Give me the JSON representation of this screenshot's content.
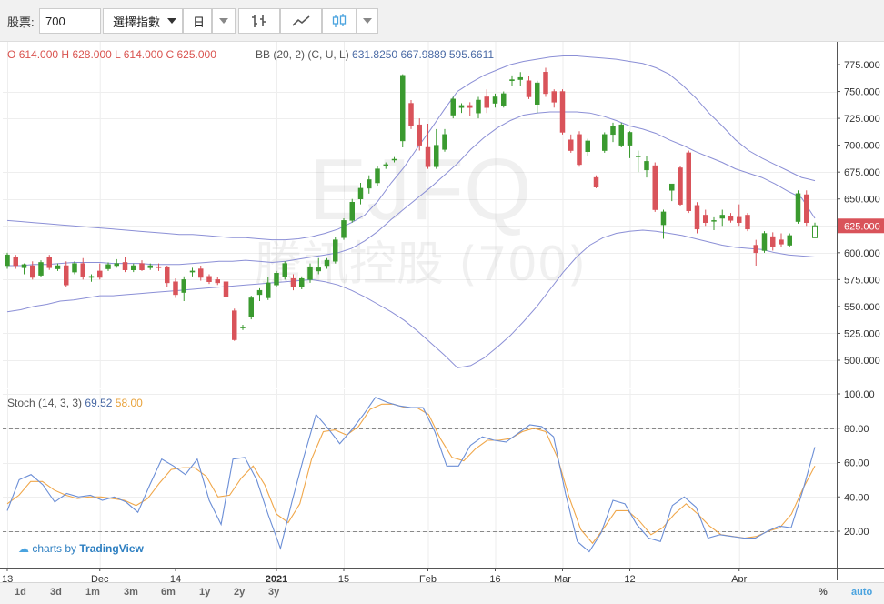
{
  "toolbar": {
    "stock_label": "股票:",
    "stock_value": "700",
    "index_select": "選擇指數",
    "period_select": "日"
  },
  "legend": {
    "o_label": "O",
    "o_value": "614.000",
    "h_label": "H",
    "h_value": "628.000",
    "l_label": "L",
    "l_value": "614.000",
    "c_label": "C",
    "c_value": "625.000",
    "bb_label": "BB (20, 2) (C, U, L)",
    "bb_c": "631.8250",
    "bb_u": "667.9889",
    "bb_l": "595.6611",
    "stoch_label": "Stoch (14, 3, 3)",
    "stoch_k": "69.52",
    "stoch_d": "58.00"
  },
  "watermark": {
    "line1": "EJFQ",
    "line2": "騰訊控股 (700)"
  },
  "branding": {
    "prefix": "charts by",
    "name": "TradingView"
  },
  "ranges": [
    "1d",
    "3d",
    "1m",
    "3m",
    "6m",
    "1y",
    "2y",
    "3y"
  ],
  "bottom_right": {
    "percent": "%",
    "auto": "auto"
  },
  "colors": {
    "up": "#3a9a2f",
    "down": "#d9535a",
    "bb": "#8b8fd6",
    "stoch_k": "#6b8ed6",
    "stoch_d": "#f0a74a"
  },
  "chart_data": [
    {
      "type": "candlestick",
      "y_axis_ticks": [
        "775.000",
        "750.000",
        "725.000",
        "700.000",
        "675.000",
        "650.000",
        "625.000",
        "600.000",
        "575.000",
        "550.000",
        "525.000",
        "500.000"
      ],
      "ylim": [
        480,
        790
      ],
      "last_price_label": "625.000",
      "x_axis_ticks": [
        "13",
        "Dec",
        "14",
        "2021",
        "15",
        "Feb",
        "16",
        "Mar",
        "12",
        "Apr"
      ],
      "x_tick_index": [
        0,
        11,
        20,
        32,
        40,
        50,
        58,
        66,
        74,
        87
      ],
      "candles": [
        {
          "o": 588,
          "h": 600,
          "l": 585,
          "c": 598
        },
        {
          "o": 596,
          "h": 598,
          "l": 585,
          "c": 588
        },
        {
          "o": 586,
          "h": 590,
          "l": 580,
          "c": 589
        },
        {
          "o": 588,
          "h": 592,
          "l": 575,
          "c": 577
        },
        {
          "o": 579,
          "h": 593,
          "l": 577,
          "c": 591
        },
        {
          "o": 596,
          "h": 598,
          "l": 584,
          "c": 586
        },
        {
          "o": 585,
          "h": 590,
          "l": 583,
          "c": 588
        },
        {
          "o": 588,
          "h": 592,
          "l": 568,
          "c": 570
        },
        {
          "o": 582,
          "h": 592,
          "l": 580,
          "c": 590
        },
        {
          "o": 590,
          "h": 595,
          "l": 575,
          "c": 578
        },
        {
          "o": 577,
          "h": 580,
          "l": 573,
          "c": 578
        },
        {
          "o": 583,
          "h": 590,
          "l": 575,
          "c": 577
        },
        {
          "o": 585,
          "h": 591,
          "l": 583,
          "c": 589
        },
        {
          "o": 588,
          "h": 594,
          "l": 586,
          "c": 590
        },
        {
          "o": 591,
          "h": 596,
          "l": 582,
          "c": 584
        },
        {
          "o": 584,
          "h": 590,
          "l": 582,
          "c": 588
        },
        {
          "o": 590,
          "h": 593,
          "l": 583,
          "c": 584
        },
        {
          "o": 586,
          "h": 590,
          "l": 584,
          "c": 588
        },
        {
          "o": 587,
          "h": 590,
          "l": 583,
          "c": 586
        },
        {
          "o": 587,
          "h": 588,
          "l": 568,
          "c": 572
        },
        {
          "o": 573,
          "h": 576,
          "l": 558,
          "c": 561
        },
        {
          "o": 563,
          "h": 578,
          "l": 555,
          "c": 575
        },
        {
          "o": 582,
          "h": 586,
          "l": 578,
          "c": 583
        },
        {
          "o": 585,
          "h": 588,
          "l": 574,
          "c": 577
        },
        {
          "o": 578,
          "h": 580,
          "l": 571,
          "c": 573
        },
        {
          "o": 575,
          "h": 577,
          "l": 570,
          "c": 572
        },
        {
          "o": 573,
          "h": 576,
          "l": 555,
          "c": 559
        },
        {
          "o": 546,
          "h": 548,
          "l": 518,
          "c": 519
        },
        {
          "o": 530,
          "h": 533,
          "l": 528,
          "c": 531
        },
        {
          "o": 540,
          "h": 560,
          "l": 538,
          "c": 558
        },
        {
          "o": 561,
          "h": 567,
          "l": 555,
          "c": 565
        },
        {
          "o": 558,
          "h": 577,
          "l": 556,
          "c": 572
        },
        {
          "o": 570,
          "h": 583,
          "l": 568,
          "c": 581
        },
        {
          "o": 578,
          "h": 592,
          "l": 575,
          "c": 590
        },
        {
          "o": 576,
          "h": 580,
          "l": 565,
          "c": 568
        },
        {
          "o": 568,
          "h": 578,
          "l": 566,
          "c": 576
        },
        {
          "o": 575,
          "h": 590,
          "l": 572,
          "c": 587
        },
        {
          "o": 583,
          "h": 595,
          "l": 580,
          "c": 586
        },
        {
          "o": 588,
          "h": 595,
          "l": 585,
          "c": 593
        },
        {
          "o": 592,
          "h": 615,
          "l": 590,
          "c": 612
        },
        {
          "o": 614,
          "h": 632,
          "l": 612,
          "c": 630
        },
        {
          "o": 630,
          "h": 650,
          "l": 628,
          "c": 647
        },
        {
          "o": 650,
          "h": 665,
          "l": 645,
          "c": 660
        },
        {
          "o": 660,
          "h": 672,
          "l": 655,
          "c": 668
        },
        {
          "o": 665,
          "h": 681,
          "l": 662,
          "c": 678
        },
        {
          "o": 682,
          "h": 684,
          "l": 678,
          "c": 682
        },
        {
          "o": 687,
          "h": 689,
          "l": 684,
          "c": 687
        },
        {
          "o": 704,
          "h": 766,
          "l": 698,
          "c": 765
        },
        {
          "o": 739,
          "h": 742,
          "l": 715,
          "c": 718
        },
        {
          "o": 719,
          "h": 725,
          "l": 695,
          "c": 700
        },
        {
          "o": 698,
          "h": 720,
          "l": 678,
          "c": 680
        },
        {
          "o": 680,
          "h": 715,
          "l": 678,
          "c": 700
        },
        {
          "o": 696,
          "h": 715,
          "l": 694,
          "c": 710
        },
        {
          "o": 728,
          "h": 745,
          "l": 725,
          "c": 743
        },
        {
          "o": 735,
          "h": 739,
          "l": 730,
          "c": 737
        },
        {
          "o": 737,
          "h": 740,
          "l": 727,
          "c": 735
        },
        {
          "o": 730,
          "h": 745,
          "l": 725,
          "c": 742
        },
        {
          "o": 745,
          "h": 752,
          "l": 730,
          "c": 735
        },
        {
          "o": 739,
          "h": 748,
          "l": 735,
          "c": 745
        },
        {
          "o": 737,
          "h": 750,
          "l": 735,
          "c": 748
        },
        {
          "o": 760,
          "h": 765,
          "l": 755,
          "c": 761
        },
        {
          "o": 761,
          "h": 768,
          "l": 755,
          "c": 763
        },
        {
          "o": 760,
          "h": 764,
          "l": 743,
          "c": 745
        },
        {
          "o": 738,
          "h": 760,
          "l": 730,
          "c": 758
        },
        {
          "o": 768,
          "h": 772,
          "l": 745,
          "c": 748
        },
        {
          "o": 750,
          "h": 752,
          "l": 735,
          "c": 740
        },
        {
          "o": 750,
          "h": 752,
          "l": 710,
          "c": 712
        },
        {
          "o": 705,
          "h": 710,
          "l": 693,
          "c": 695
        },
        {
          "o": 710,
          "h": 713,
          "l": 680,
          "c": 682
        },
        {
          "o": 694,
          "h": 706,
          "l": 690,
          "c": 704
        },
        {
          "o": 670,
          "h": 672,
          "l": 660,
          "c": 661
        },
        {
          "o": 695,
          "h": 712,
          "l": 693,
          "c": 710
        },
        {
          "o": 710,
          "h": 721,
          "l": 703,
          "c": 718
        },
        {
          "o": 700,
          "h": 721,
          "l": 698,
          "c": 719
        },
        {
          "o": 700,
          "h": 713,
          "l": 688,
          "c": 712
        },
        {
          "o": 690,
          "h": 695,
          "l": 675,
          "c": 690
        },
        {
          "o": 677,
          "h": 690,
          "l": 670,
          "c": 685
        },
        {
          "o": 681,
          "h": 684,
          "l": 638,
          "c": 640
        },
        {
          "o": 626,
          "h": 640,
          "l": 613,
          "c": 638
        },
        {
          "o": 658,
          "h": 663,
          "l": 648,
          "c": 664
        },
        {
          "o": 679,
          "h": 681,
          "l": 643,
          "c": 645
        },
        {
          "o": 693,
          "h": 695,
          "l": 637,
          "c": 639
        },
        {
          "o": 644,
          "h": 647,
          "l": 618,
          "c": 622
        },
        {
          "o": 635,
          "h": 640,
          "l": 625,
          "c": 628
        },
        {
          "o": 630,
          "h": 633,
          "l": 621,
          "c": 630
        },
        {
          "o": 632,
          "h": 640,
          "l": 625,
          "c": 635
        },
        {
          "o": 634,
          "h": 637,
          "l": 628,
          "c": 630
        },
        {
          "o": 633,
          "h": 645,
          "l": 625,
          "c": 628
        },
        {
          "o": 635,
          "h": 637,
          "l": 620,
          "c": 622
        },
        {
          "o": 607,
          "h": 612,
          "l": 588,
          "c": 600
        },
        {
          "o": 602,
          "h": 620,
          "l": 600,
          "c": 618
        },
        {
          "o": 615,
          "h": 619,
          "l": 602,
          "c": 606
        },
        {
          "o": 612,
          "h": 618,
          "l": 605,
          "c": 608
        },
        {
          "o": 607,
          "h": 618,
          "l": 605,
          "c": 616
        },
        {
          "o": 629,
          "h": 658,
          "l": 627,
          "c": 655
        },
        {
          "o": 654,
          "h": 658,
          "l": 625,
          "c": 628
        },
        {
          "o": 614,
          "h": 628,
          "l": 614,
          "c": 625
        }
      ],
      "bb_upper": [
        630,
        629,
        628,
        627,
        626,
        625,
        624,
        623,
        622,
        621,
        620,
        619,
        618,
        617,
        617,
        616,
        615,
        614,
        614,
        613,
        612,
        612,
        613,
        615,
        618,
        622,
        628,
        635,
        648,
        665,
        680,
        698,
        715,
        733,
        750,
        758,
        765,
        770,
        775,
        778,
        780,
        782,
        783,
        783,
        782,
        781,
        780,
        778,
        776,
        772,
        766,
        756,
        744,
        730,
        718,
        705,
        695,
        688,
        682,
        676,
        670,
        667
      ],
      "bb_lower": [
        545,
        547,
        550,
        552,
        555,
        556,
        558,
        560,
        560,
        561,
        562,
        563,
        564,
        565,
        566,
        567,
        568,
        569,
        570,
        571,
        572,
        573,
        574,
        575,
        573,
        570,
        565,
        559,
        552,
        545,
        537,
        527,
        516,
        505,
        493,
        495,
        502,
        512,
        523,
        536,
        550,
        566,
        582,
        596,
        607,
        614,
        618,
        620,
        621,
        620,
        618,
        616,
        613,
        610,
        607,
        605,
        604,
        603,
        600,
        598,
        597,
        596
      ],
      "bb_mid": [
        588,
        588,
        589,
        589,
        590,
        591,
        591,
        591,
        590,
        590,
        590,
        589,
        589,
        589,
        590,
        591,
        592,
        592,
        593,
        592,
        591,
        592,
        594,
        596,
        598,
        600,
        604,
        611,
        620,
        631,
        641,
        651,
        661,
        672,
        683,
        696,
        707,
        716,
        723,
        728,
        730,
        731,
        731,
        731,
        730,
        727,
        723,
        718,
        715,
        711,
        705,
        700,
        694,
        689,
        684,
        678,
        674,
        670,
        664,
        657,
        651,
        632
      ]
    },
    {
      "type": "line",
      "title": "Stoch (14, 3, 3)",
      "y_axis_ticks": [
        "100.00",
        "80.00",
        "60.00",
        "40.00",
        "20.00"
      ],
      "ylim": [
        0,
        100
      ],
      "levels": [
        80,
        20
      ],
      "series": [
        {
          "name": "%K",
          "values": [
            32,
            50,
            53,
            47,
            37,
            42,
            40,
            41,
            38,
            40,
            37,
            31,
            47,
            62,
            58,
            53,
            62,
            38,
            24,
            62,
            63,
            50,
            29,
            10,
            38,
            64,
            88,
            80,
            71,
            79,
            88,
            98,
            95,
            93,
            92,
            92,
            78,
            58,
            58,
            70,
            75,
            73,
            72,
            77,
            82,
            81,
            75,
            42,
            14,
            8,
            19,
            38,
            36,
            24,
            16,
            14,
            35,
            40,
            34,
            16,
            18,
            17,
            16,
            16,
            20,
            23,
            22,
            44,
            69
          ]
        },
        {
          "name": "%D",
          "values": [
            36,
            41,
            49,
            49,
            44,
            41,
            39,
            40,
            40,
            39,
            38,
            35,
            39,
            48,
            56,
            57,
            57,
            52,
            40,
            41,
            51,
            58,
            47,
            30,
            25,
            36,
            62,
            78,
            79,
            76,
            81,
            91,
            94,
            94,
            92,
            92,
            88,
            74,
            63,
            61,
            68,
            73,
            73,
            74,
            78,
            80,
            78,
            63,
            40,
            21,
            13,
            22,
            32,
            32,
            26,
            18,
            22,
            30,
            36,
            30,
            23,
            18,
            17,
            16,
            17,
            20,
            22,
            30,
            45,
            58
          ]
        }
      ]
    }
  ]
}
